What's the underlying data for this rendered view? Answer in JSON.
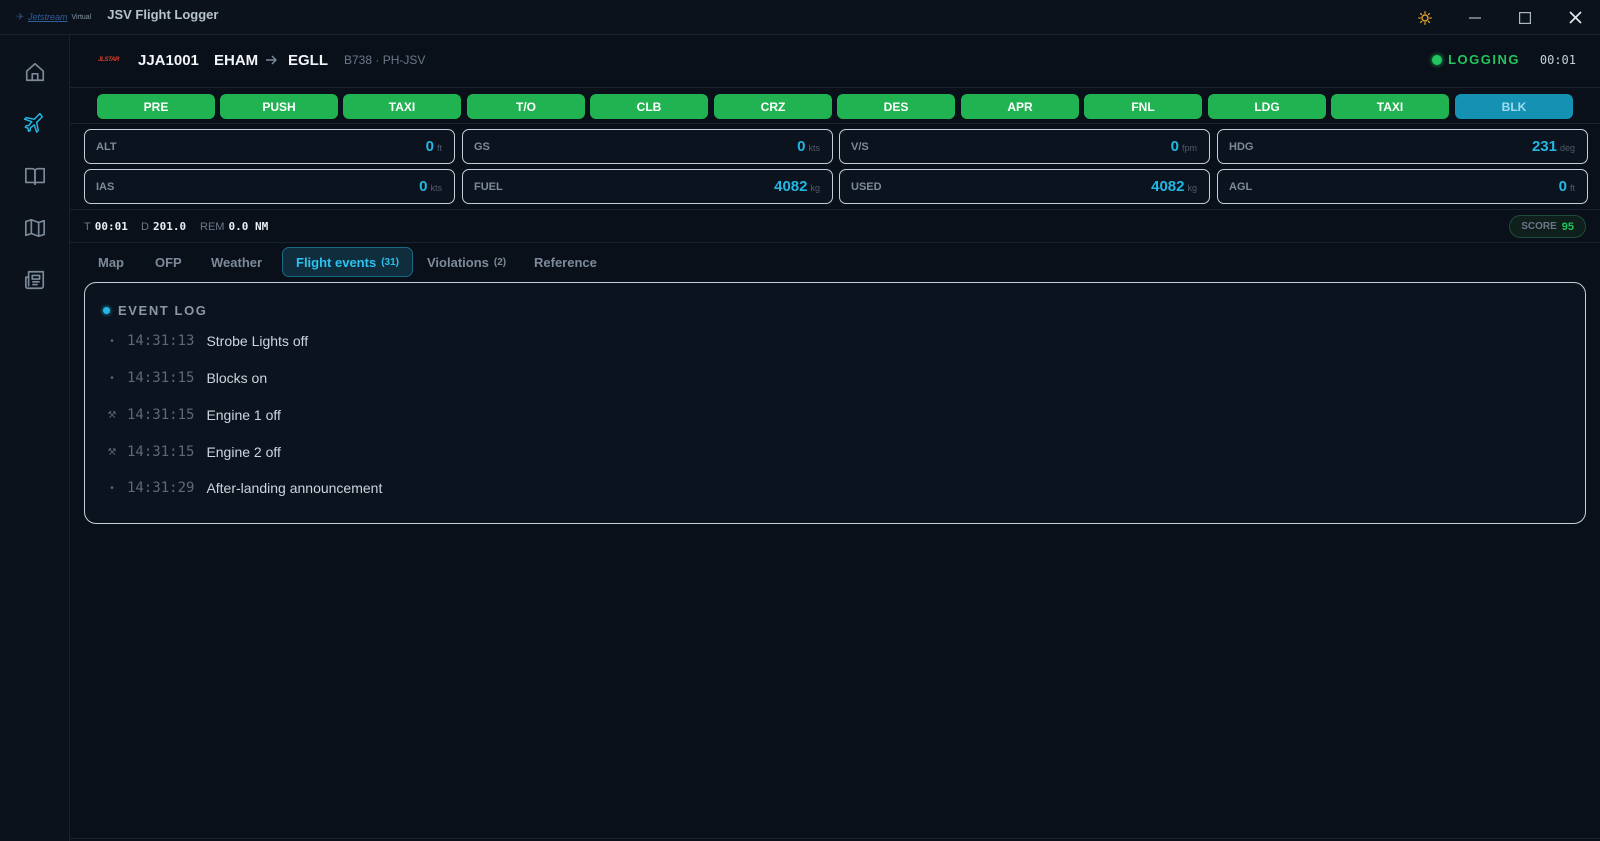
{
  "window": {
    "brand_name": "Jetstream",
    "brand_sub": "Virtual",
    "title": "JSV Flight Logger",
    "icons": [
      "sun-icon",
      "minimize-icon",
      "maximize-icon",
      "close-icon"
    ]
  },
  "sidebar": {
    "items": [
      {
        "name": "home",
        "icon": "home-icon"
      },
      {
        "name": "flight",
        "icon": "plane-icon"
      },
      {
        "name": "logbook",
        "icon": "book-icon"
      },
      {
        "name": "map",
        "icon": "map-icon"
      },
      {
        "name": "news",
        "icon": "newspaper-icon"
      }
    ]
  },
  "flight": {
    "logo_text": "JLSTAR",
    "callsign": "JJA1001",
    "departure": "EHAM",
    "arrival": "EGLL",
    "aircraft": "B738 · PH-JSV",
    "status": "LOGGING",
    "timer": "00:01"
  },
  "phases": [
    {
      "label": "PRE",
      "state": "done"
    },
    {
      "label": "PUSH",
      "state": "done"
    },
    {
      "label": "TAXI",
      "state": "done"
    },
    {
      "label": "T/O",
      "state": "done"
    },
    {
      "label": "CLB",
      "state": "done"
    },
    {
      "label": "CRZ",
      "state": "done"
    },
    {
      "label": "DES",
      "state": "done"
    },
    {
      "label": "APR",
      "state": "done"
    },
    {
      "label": "FNL",
      "state": "done"
    },
    {
      "label": "LDG",
      "state": "done"
    },
    {
      "label": "TAXI",
      "state": "done"
    },
    {
      "label": "BLK",
      "state": "active"
    }
  ],
  "metrics": [
    {
      "label": "ALT",
      "value": "0",
      "unit": "ft"
    },
    {
      "label": "GS",
      "value": "0",
      "unit": "kts"
    },
    {
      "label": "V/S",
      "value": "0",
      "unit": "fpm"
    },
    {
      "label": "HDG",
      "value": "231",
      "unit": "deg"
    },
    {
      "label": "IAS",
      "value": "0",
      "unit": "kts"
    },
    {
      "label": "FUEL",
      "value": "4082",
      "unit": "kg"
    },
    {
      "label": "USED",
      "value": "4082",
      "unit": "kg"
    },
    {
      "label": "AGL",
      "value": "0",
      "unit": "ft"
    }
  ],
  "status": {
    "t_label": "T",
    "t_value": "00:01",
    "d_label": "D",
    "d_value": "201.0",
    "rem_label": "REM",
    "rem_value": "0.0 NM",
    "score_label": "SCORE",
    "score_value": "95"
  },
  "tabs": [
    {
      "label": "Map",
      "count": ""
    },
    {
      "label": "OFP",
      "count": ""
    },
    {
      "label": "Weather",
      "count": ""
    },
    {
      "label": "Flight events",
      "count": "(31)",
      "active": true
    },
    {
      "label": "Violations",
      "count": "(2)"
    },
    {
      "label": "Reference",
      "count": ""
    }
  ],
  "event_log": {
    "title": "EVENT LOG",
    "events": [
      {
        "icon": "bullet-icon",
        "glyph": "•",
        "time": "14:31:13",
        "text": "Strobe Lights off"
      },
      {
        "icon": "bullet-icon",
        "glyph": "•",
        "time": "14:31:15",
        "text": "Blocks on"
      },
      {
        "icon": "engine-icon",
        "glyph": "⚒",
        "time": "14:31:15",
        "text": "Engine 1 off"
      },
      {
        "icon": "engine-icon",
        "glyph": "⚒",
        "time": "14:31:15",
        "text": "Engine 2 off"
      },
      {
        "icon": "bullet-icon",
        "glyph": "•",
        "time": "14:31:29",
        "text": "After-landing announcement"
      }
    ]
  },
  "colors": {
    "background": "#0a1019",
    "phase_done": "#21b352",
    "phase_active": "#1592b3",
    "accent": "#22b8e6",
    "logging": "#22c55e"
  }
}
